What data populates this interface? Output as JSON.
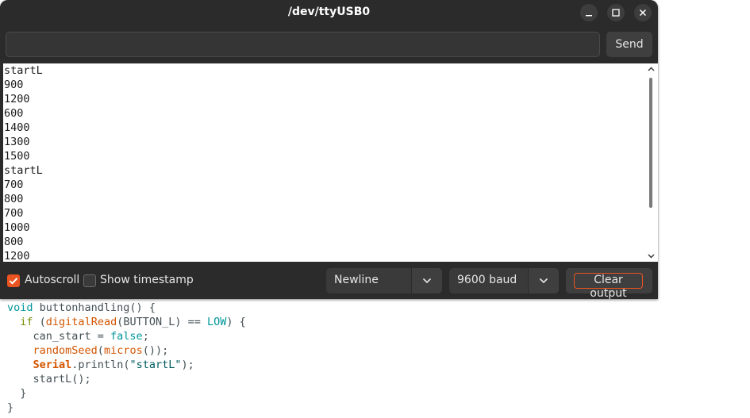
{
  "window": {
    "title": "/dev/ttyUSB0",
    "send_label": "Send",
    "input_value": ""
  },
  "output": {
    "lines": [
      "startL",
      "900",
      "1200",
      "600",
      "1400",
      "1300",
      "1500",
      "startL",
      "700",
      "800",
      "700",
      "1000",
      "800",
      "1200"
    ]
  },
  "controls": {
    "autoscroll_label": "Autoscroll",
    "autoscroll_checked": true,
    "timestamp_label": "Show timestamp",
    "timestamp_checked": false,
    "line_ending": "Newline",
    "baud_rate": "9600 baud",
    "clear_label": "Clear output"
  },
  "code": {
    "l1": {
      "a": "void",
      "b": " buttonhandling() {"
    },
    "l2": {
      "a": "  ",
      "b": "if",
      "c": " (",
      "d": "digitalRead",
      "e": "(BUTTON_L) == ",
      "f": "LOW",
      "g": ") {"
    },
    "l3": {
      "a": "    can_start = ",
      "b": "false",
      "c": ";"
    },
    "l4": {
      "a": "    ",
      "b": "randomSeed",
      "c": "(",
      "d": "micros",
      "e": "());"
    },
    "l5": {
      "a": "    ",
      "b": "Serial",
      "c": ".println(",
      "d": "\"startL\"",
      "e": ");"
    },
    "l6": {
      "a": "    startL();"
    },
    "l7": {
      "a": "  }"
    },
    "l8": {
      "a": "}"
    }
  },
  "colors": {
    "accent": "#e95420",
    "window_bg": "#2b2b2b",
    "output_bg": "#ffffff"
  }
}
